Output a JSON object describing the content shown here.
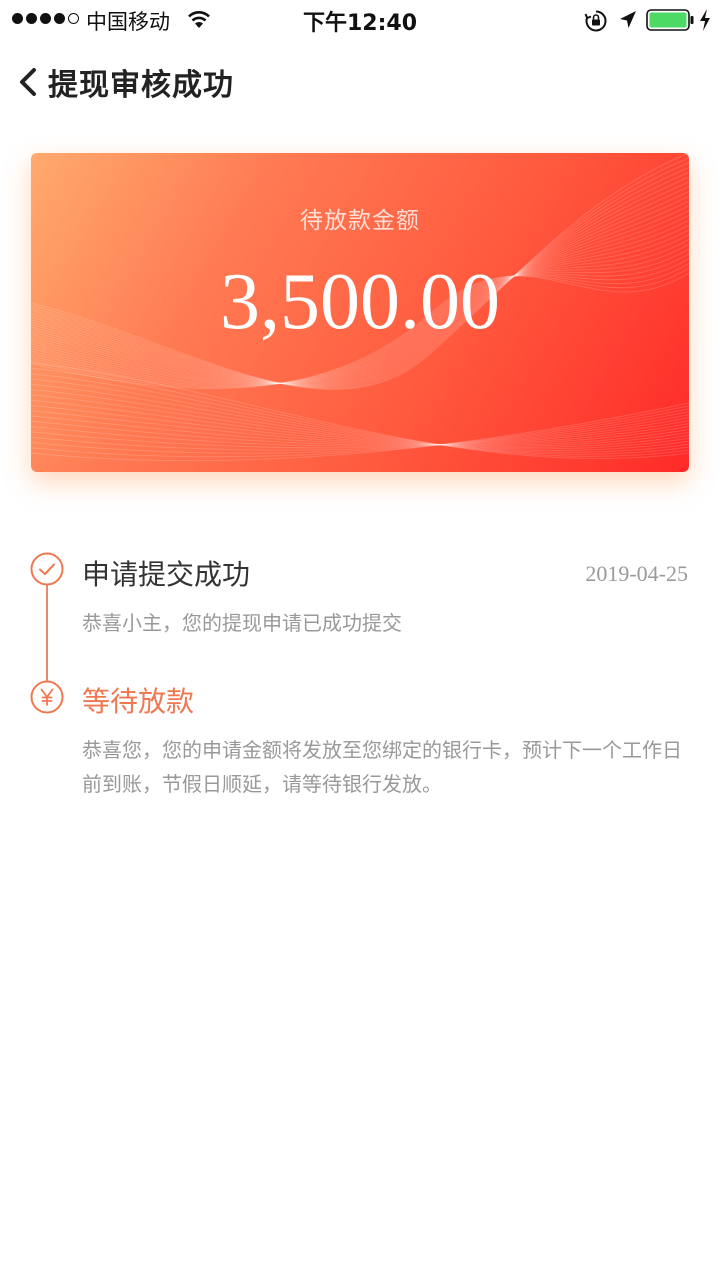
{
  "status_bar": {
    "carrier": "中国移动",
    "time": "下午12:40",
    "battery_color": "#4cd964"
  },
  "nav": {
    "title": "提现审核成功"
  },
  "card": {
    "label": "待放款金额",
    "amount": "3,500.00",
    "gradient_colors": [
      "#ffaa6e",
      "#ff7a52",
      "#ff5a3e",
      "#ff2a28"
    ]
  },
  "timeline": {
    "accent_color": "#f07850",
    "steps": [
      {
        "icon": "check-icon",
        "title": "申请提交成功",
        "date": "2019-04-25",
        "description": "恭喜小主，您的提现申请已成功提交"
      },
      {
        "icon": "yen-icon",
        "title": "等待放款",
        "description": "恭喜您，您的申请金额将发放至您绑定的银行卡，预计下一个工作日前到账，节假日顺延，请等待银行发放。"
      }
    ]
  }
}
